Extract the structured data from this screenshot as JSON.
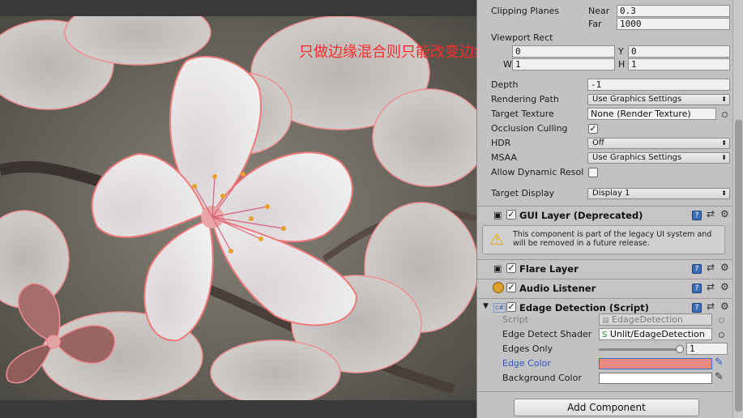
{
  "overlay_caption": "只做边缘混合则只能改变边缘色",
  "camera": {
    "clipping_planes_label": "Clipping Planes",
    "near_label": "Near",
    "near_value": "0.3",
    "far_label": "Far",
    "far_value": "1000",
    "viewport_rect_label": "Viewport Rect",
    "x_label": "X",
    "x_value": "0",
    "y_label": "Y",
    "y_value": "0",
    "w_label": "W",
    "w_value": "1",
    "h_label": "H",
    "h_value": "1",
    "depth_label": "Depth",
    "depth_value": "-1",
    "rendering_path_label": "Rendering Path",
    "rendering_path_value": "Use Graphics Settings",
    "target_texture_label": "Target Texture",
    "target_texture_value": "None (Render Texture)",
    "occlusion_culling_label": "Occlusion Culling",
    "hdr_label": "HDR",
    "hdr_value": "Off",
    "msaa_label": "MSAA",
    "msaa_value": "Use Graphics Settings",
    "allow_dynamic_label": "Allow Dynamic Resol",
    "target_display_label": "Target Display",
    "target_display_value": "Display 1"
  },
  "components": {
    "gui_layer_title": "GUI Layer (Deprecated)",
    "gui_layer_warning": "This component is part of the legacy UI system and will be removed in a future release.",
    "flare_layer_title": "Flare Layer",
    "audio_listener_title": "Audio Listener",
    "edge_title": "Edage Detection (Script)"
  },
  "edge_detection": {
    "script_label": "Script",
    "script_value": "EdageDetection",
    "shader_label": "Edge Detect Shader",
    "shader_value": "Unlit/EdageDetection",
    "edges_only_label": "Edges Only",
    "edges_only_value": "1",
    "edges_only_fraction": 1.0,
    "edge_color_label": "Edge Color",
    "edge_color_hex": "#e98a86",
    "background_color_label": "Background Color",
    "background_color_hex": "#ffffff"
  },
  "add_component_label": "Add Component",
  "colors": {
    "inspector_bg": "#c2c2c2",
    "highlight_label": "#2e57c8",
    "edge_tint": "#ff7b7b"
  }
}
